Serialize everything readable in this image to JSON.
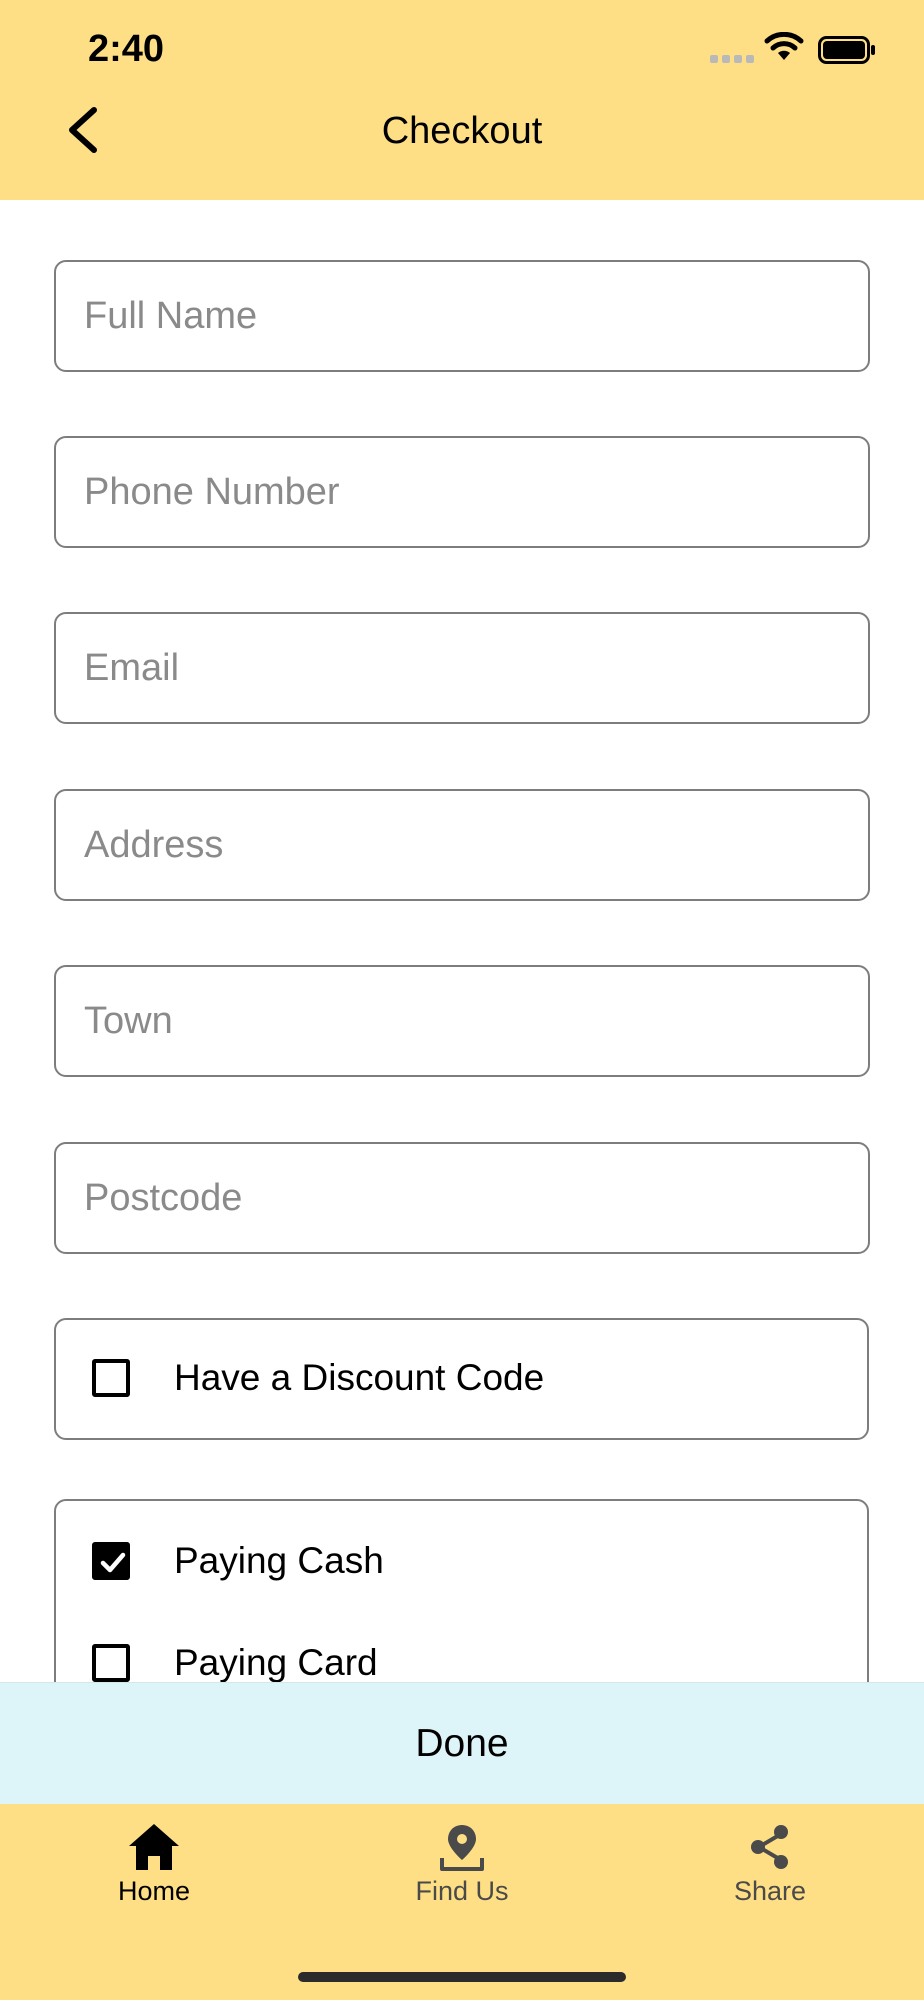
{
  "status_bar": {
    "time": "2:40"
  },
  "header": {
    "title": "Checkout"
  },
  "form": {
    "fields": [
      {
        "placeholder": "Full Name",
        "value": ""
      },
      {
        "placeholder": "Phone Number",
        "value": ""
      },
      {
        "placeholder": "Email",
        "value": ""
      },
      {
        "placeholder": "Address",
        "value": ""
      },
      {
        "placeholder": "Town",
        "value": ""
      },
      {
        "placeholder": "Postcode",
        "value": ""
      }
    ],
    "discount": {
      "label": "Have a Discount Code",
      "checked": false
    },
    "payment": {
      "options": [
        {
          "label": "Paying Cash",
          "checked": true
        },
        {
          "label": "Paying Card",
          "checked": false
        }
      ]
    }
  },
  "done_button": {
    "label": "Done"
  },
  "tabbar": {
    "items": [
      {
        "label": "Home",
        "icon": "home-icon",
        "active": true
      },
      {
        "label": "Find Us",
        "icon": "map-pin-icon",
        "active": false
      },
      {
        "label": "Share",
        "icon": "share-icon",
        "active": false
      }
    ]
  },
  "colors": {
    "header_bg": "#FFDF85",
    "done_bg": "#DDF4F8",
    "field_border": "#7d7d7d",
    "placeholder": "#8a8a8a"
  }
}
